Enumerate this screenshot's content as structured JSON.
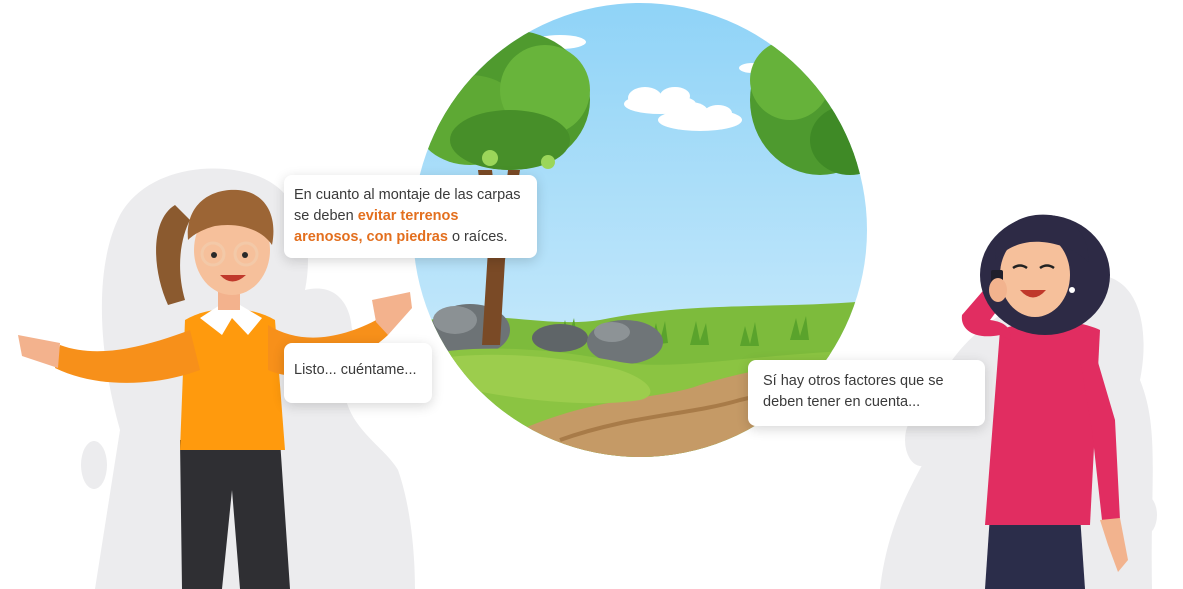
{
  "conversation": {
    "bubble_1": {
      "text_before": "En cuanto al montaje de las carpas se deben ",
      "highlight": "evitar terrenos arenosos, con piedras",
      "text_after": " o raíces."
    },
    "bubble_2": {
      "text": "Listo... cuéntame..."
    },
    "bubble_3": {
      "text": "Sí hay otros factores que se deben tener en cuenta..."
    }
  },
  "colors": {
    "highlight": "#e36f1e",
    "sky": "#a9dcf7",
    "shirt_left": "#ff9a0d",
    "shirt_right": "#e12d61",
    "background_shape": "#ececee"
  }
}
